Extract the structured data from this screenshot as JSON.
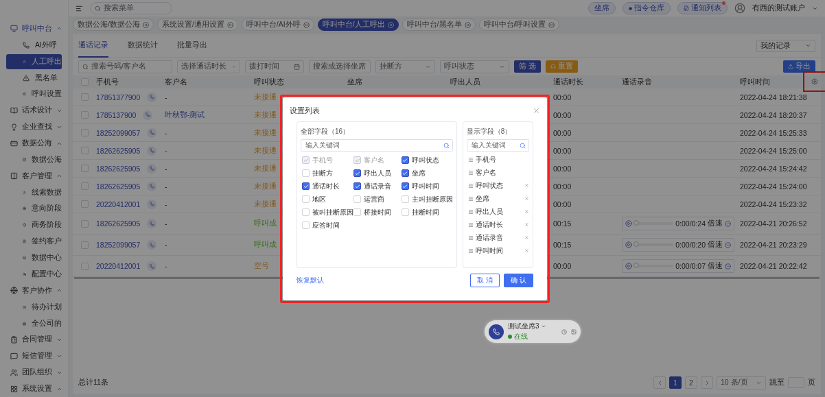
{
  "sidebar": {
    "groups": [
      {
        "label": "呼叫中台",
        "selected": true,
        "expanded": true,
        "children": [
          {
            "label": "AI外呼",
            "selected": false
          },
          {
            "label": "人工呼出",
            "selected": true
          },
          {
            "label": "黑名单",
            "selected": false
          },
          {
            "label": "呼叫设置",
            "selected": false
          }
        ]
      },
      {
        "label": "话术设计",
        "selected": false,
        "expanded": false
      },
      {
        "label": "企业查找",
        "selected": false,
        "expanded": false
      },
      {
        "label": "数据公海",
        "selected": false,
        "expanded": true,
        "children": [
          {
            "label": "数据公海",
            "selected": false
          }
        ]
      },
      {
        "label": "客户管理",
        "selected": false,
        "expanded": true,
        "children": [
          {
            "label": "线索数据",
            "selected": false
          },
          {
            "label": "意向阶段",
            "selected": false
          },
          {
            "label": "商务阶段",
            "selected": false
          },
          {
            "label": "签约客户",
            "selected": false
          },
          {
            "label": "数据中心",
            "selected": false
          },
          {
            "label": "配置中心",
            "selected": false
          }
        ]
      },
      {
        "label": "客户协作",
        "selected": false,
        "expanded": true,
        "children": [
          {
            "label": "待办计划",
            "selected": false
          },
          {
            "label": "全公司的",
            "selected": false
          }
        ]
      },
      {
        "label": "合同管理",
        "selected": false,
        "expanded": false
      },
      {
        "label": "短信管理",
        "selected": false,
        "expanded": false
      },
      {
        "label": "团队组织",
        "selected": false,
        "expanded": false
      },
      {
        "label": "系统设置",
        "selected": false,
        "expanded": true
      }
    ]
  },
  "topbar": {
    "search_placeholder": "搜索菜单",
    "buttons": [
      "坐席",
      "指令仓库",
      "通知列表"
    ],
    "notification_dot": true,
    "account": "有西的测试账户"
  },
  "page_tabs": [
    {
      "label": "数据公海/数据公海",
      "selected": false
    },
    {
      "label": "系统设置/通用设置",
      "selected": false
    },
    {
      "label": "呼叫中台/AI外呼",
      "selected": false
    },
    {
      "label": "呼叫中台/人工呼出",
      "selected": true
    },
    {
      "label": "呼叫中台/黑名单",
      "selected": false
    },
    {
      "label": "呼叫中台/呼叫设置",
      "selected": false
    }
  ],
  "inner_tabs": [
    {
      "label": "通话记录",
      "selected": true
    },
    {
      "label": "数据统计",
      "selected": false
    },
    {
      "label": "批量导出",
      "selected": false
    }
  ],
  "record_scope": "我的记录",
  "filters": {
    "search_placeholder": "搜索号码/客户名",
    "duration_placeholder": "选择通话时长",
    "time_placeholder": "拨打时间",
    "seat_placeholder": "搜索或选择坐席",
    "hangup_placeholder": "挂断方",
    "status_placeholder": "呼叫状态",
    "filter_button": "筛 选",
    "reset_button": "重置",
    "export_button": "导出"
  },
  "table": {
    "all_checked": false,
    "columns": [
      "手机号",
      "客户名",
      "呼叫状态",
      "坐席",
      "呼出人员",
      "通话时长",
      "通话录音",
      "呼叫时间"
    ],
    "rows": [
      {
        "checked": false,
        "phone": "17851377900",
        "name": "-",
        "name_linked": false,
        "status": {
          "text": "未接通",
          "kind": "missed"
        },
        "duration": "00:00",
        "time": "2022-04-24 18:21:38"
      },
      {
        "checked": false,
        "phone": "1785137900",
        "name": "叶秋鄂-测试",
        "name_linked": true,
        "status": {
          "text": "未接通",
          "kind": "missed"
        },
        "duration": "00:00",
        "time": "2022-04-24 18:20:37"
      },
      {
        "checked": false,
        "phone": "18252099057",
        "name": "-",
        "name_linked": false,
        "status": {
          "text": "未接通",
          "kind": "missed"
        },
        "duration": "00:00",
        "time": "2022-04-24 15:25:33"
      },
      {
        "checked": false,
        "phone": "18262625905",
        "name": "-",
        "name_linked": false,
        "status": {
          "text": "未接通",
          "kind": "missed"
        },
        "duration": "00:00",
        "time": "2022-04-24 15:25:00"
      },
      {
        "checked": false,
        "phone": "18262625905",
        "name": "-",
        "name_linked": false,
        "status": {
          "text": "未接通",
          "kind": "missed"
        },
        "duration": "00:00",
        "time": "2022-04-24 15:24:42"
      },
      {
        "checked": false,
        "phone": "18262625905",
        "name": "-",
        "name_linked": false,
        "status": {
          "text": "未接通",
          "kind": "missed"
        },
        "duration": "00:00",
        "time": "2022-04-24 15:24:00"
      },
      {
        "checked": false,
        "phone": "20220412001",
        "name": "-",
        "name_linked": false,
        "status": {
          "text": "未接通",
          "kind": "missed"
        },
        "duration": "00:00",
        "time": "2022-04-24 15:23:32"
      },
      {
        "checked": false,
        "phone": "18262625905",
        "name": "-",
        "name_linked": false,
        "status": {
          "text": "呼叫成",
          "kind": "success"
        },
        "duration": "00:15",
        "recording": {
          "time": "0:00/0:24",
          "speed": "倍速",
          "level": 0
        },
        "time": "2022-04-21 20:26:52"
      },
      {
        "checked": false,
        "phone": "18252099057",
        "name": "-",
        "name_linked": false,
        "status": {
          "text": "呼叫成",
          "kind": "success"
        },
        "duration": "00:15",
        "recording": {
          "time": "0:00/0:20",
          "speed": "倍速",
          "level": 0
        },
        "time": "2022-04-21 20:23:29"
      },
      {
        "checked": false,
        "phone": "20220412001",
        "name": "-",
        "name_linked": false,
        "status": {
          "text": "空号",
          "kind": "missed"
        },
        "duration": "00:00",
        "recording": {
          "time": "0:00/0:07",
          "speed": "倍速",
          "level": 0
        },
        "time": "2022-04-21 20:22:42"
      }
    ]
  },
  "pagination": {
    "total": "总计11条",
    "pages": [
      {
        "label": "1",
        "selected": true
      },
      {
        "label": "2",
        "selected": false
      }
    ],
    "page_size": "10 条/页",
    "jump_label": "跳至",
    "page_unit": "页"
  },
  "call_widget": {
    "seat": "测试坐席3",
    "status": "在线",
    "online": true
  },
  "dialog": {
    "title": "设置列表",
    "all_fields": {
      "title": "全部字段（16）",
      "search_placeholder": "输入关键词",
      "fields": [
        {
          "label": "手机号",
          "checked": true,
          "disabled": true
        },
        {
          "label": "客户名",
          "checked": true,
          "disabled": true
        },
        {
          "label": "呼叫状态",
          "checked": true,
          "disabled": false
        },
        {
          "label": "挂断方",
          "checked": false,
          "disabled": false
        },
        {
          "label": "呼出人员",
          "checked": true,
          "disabled": false
        },
        {
          "label": "坐席",
          "checked": true,
          "disabled": false
        },
        {
          "label": "通话时长",
          "checked": true,
          "disabled": false
        },
        {
          "label": "通话录音",
          "checked": true,
          "disabled": false
        },
        {
          "label": "呼叫时间",
          "checked": true,
          "disabled": false
        },
        {
          "label": "地区",
          "checked": false,
          "disabled": false
        },
        {
          "label": "运营商",
          "checked": false,
          "disabled": false
        },
        {
          "label": "主叫挂断原因",
          "checked": false,
          "disabled": false
        },
        {
          "label": "被叫挂断原因",
          "checked": false,
          "disabled": false
        },
        {
          "label": "桥接时间",
          "checked": false,
          "disabled": false
        },
        {
          "label": "挂断时间",
          "checked": false,
          "disabled": false
        },
        {
          "label": "应答时间",
          "checked": false,
          "disabled": false
        }
      ]
    },
    "shown_fields": {
      "title": "显示字段（8）",
      "search_placeholder": "输入关键词",
      "fields": [
        {
          "label": "手机号",
          "removable": false
        },
        {
          "label": "客户名",
          "removable": false
        },
        {
          "label": "呼叫状态",
          "removable": true
        },
        {
          "label": "坐席",
          "removable": true
        },
        {
          "label": "呼出人员",
          "removable": true
        },
        {
          "label": "通话时长",
          "removable": true
        },
        {
          "label": "通话录音",
          "removable": true
        },
        {
          "label": "呼叫时间",
          "removable": true
        }
      ]
    },
    "reset_link": "恢复默认",
    "cancel_button": "取 消",
    "confirm_button": "确 认"
  }
}
